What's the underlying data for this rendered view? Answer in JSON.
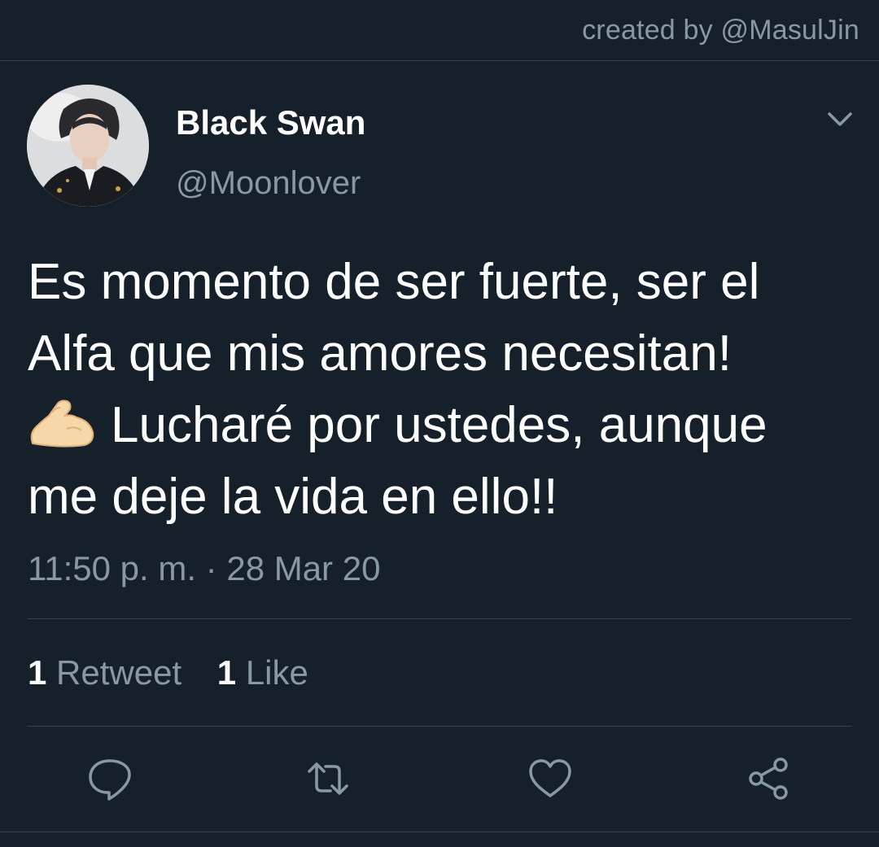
{
  "credit": "created by @MasulJin",
  "tweet": {
    "display_name": "Black Swan",
    "handle": "@Moonlover",
    "text_lines": [
      "Es momento de ser fuerte, ser el",
      "Alfa que mis amores necesitan!",
      "Lucharé por ustedes, aunque",
      "me deje la vida en ello!!"
    ],
    "emoji": "flexed-biceps-emoji",
    "timestamp": "11:50 p. m. · 28 Mar 20",
    "retweet_count": "1",
    "retweet_label": "Retweet",
    "like_count": "1",
    "like_label": "Like"
  },
  "icons": {
    "caret": "chevron-down-icon",
    "reply": "reply-icon",
    "retweet": "retweet-icon",
    "like": "heart-icon",
    "share": "share-icon"
  },
  "colors": {
    "background": "#15202b",
    "secondary_text": "#8899a6",
    "divider": "#38444d",
    "primary_text": "#ffffff"
  }
}
